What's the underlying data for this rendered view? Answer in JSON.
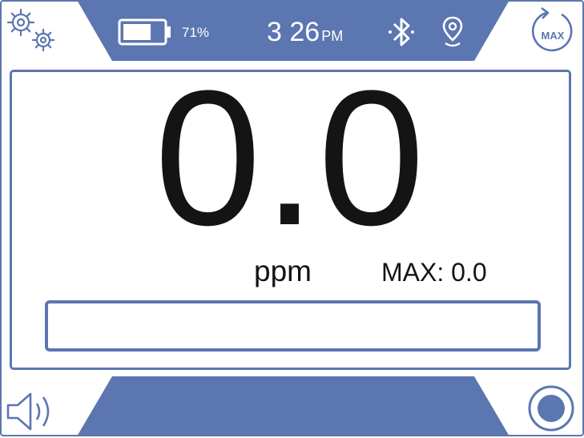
{
  "colors": {
    "frame_blue": "#5b76b0",
    "text": "#141414",
    "background": "#ffffff"
  },
  "status_bar": {
    "battery_percent_label": "71%",
    "battery_level": 0.71,
    "time": "3 26",
    "ampm": "PM",
    "icons": [
      "settings-gear-icon",
      "battery-icon",
      "bluetooth-icon",
      "gps-location-icon",
      "max-reset-icon"
    ]
  },
  "reading": {
    "value": "0.0",
    "unit": "ppm",
    "max_label": "MAX: 0.0",
    "bar_fill_fraction": 0.0
  },
  "buttons": {
    "max_reset_label": "MAX"
  },
  "bottom_icons": [
    "speaker-icon",
    "record-button-icon"
  ]
}
